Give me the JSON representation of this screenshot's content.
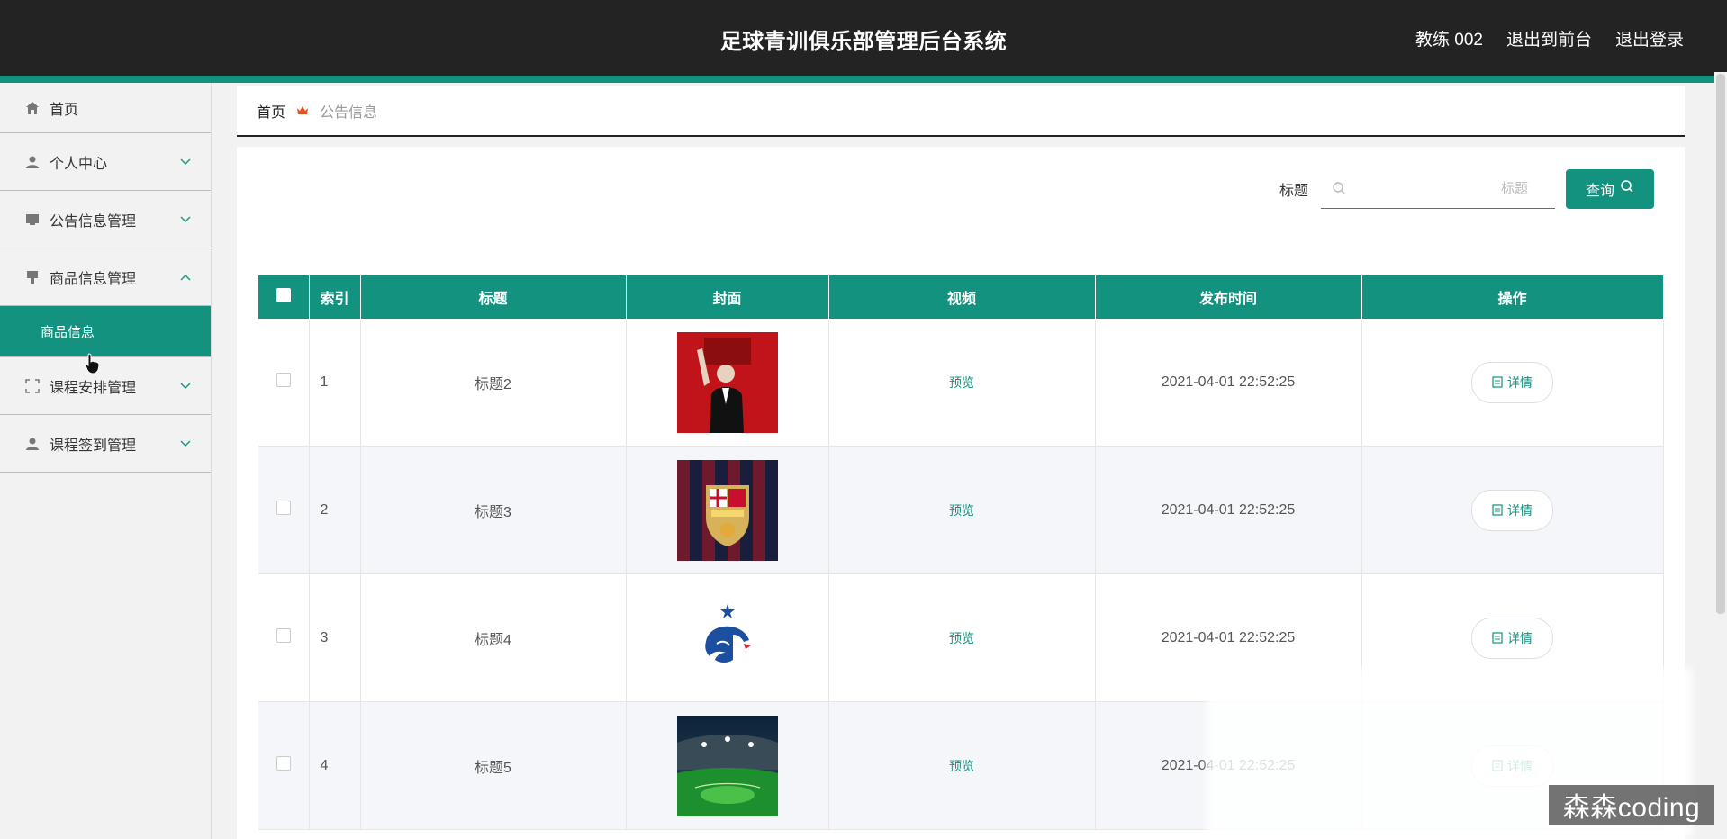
{
  "header": {
    "title": "足球青训俱乐部管理后台系统",
    "user_label": "教练 002",
    "to_front_label": "退出到前台",
    "logout_label": "退出登录"
  },
  "sidebar": {
    "items": [
      {
        "label": "首页",
        "icon": "home-icon"
      },
      {
        "label": "个人中心",
        "icon": "user-icon"
      },
      {
        "label": "公告信息管理",
        "icon": "notice-icon"
      },
      {
        "label": "商品信息管理",
        "icon": "goods-icon",
        "expanded": true
      },
      {
        "label": "课程安排管理",
        "icon": "schedule-icon"
      },
      {
        "label": "课程签到管理",
        "icon": "checkin-icon"
      }
    ],
    "submenu": {
      "label": "商品信息"
    }
  },
  "breadcrumb": {
    "home": "首页",
    "current": "公告信息"
  },
  "search": {
    "label": "标题",
    "placeholder": "标题",
    "button_label": "查询"
  },
  "table": {
    "headers": [
      "索引",
      "标题",
      "封面",
      "视频",
      "发布时间",
      "操作"
    ],
    "rows": [
      {
        "index": "1",
        "title": "标题2",
        "cover": "liverpool-figure",
        "video": "预览",
        "time": "2021-04-01 22:52:25",
        "action": "详情"
      },
      {
        "index": "2",
        "title": "标题3",
        "cover": "fcb-crest",
        "video": "预览",
        "time": "2021-04-01 22:52:25",
        "action": "详情"
      },
      {
        "index": "3",
        "title": "标题4",
        "cover": "france-rooster",
        "video": "预览",
        "time": "2021-04-01 22:52:25",
        "action": "详情"
      },
      {
        "index": "4",
        "title": "标题5",
        "cover": "stadium",
        "video": "预览",
        "time": "2021-04-01 22:52:25",
        "action": "详情"
      }
    ]
  },
  "watermark": "森森coding",
  "colors": {
    "accent": "#12927f",
    "header_bg": "#232323"
  }
}
